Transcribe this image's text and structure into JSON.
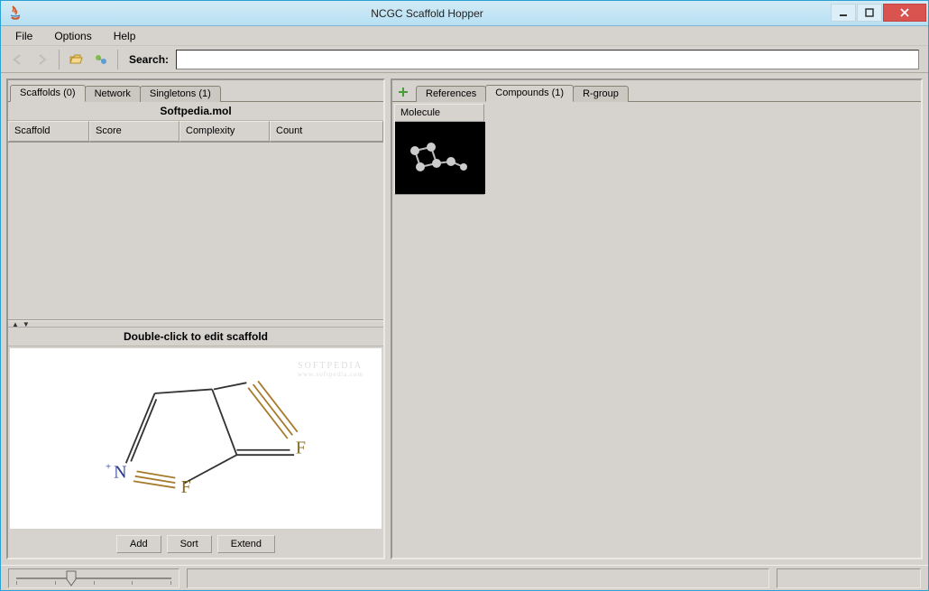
{
  "window": {
    "title": "NCGC Scaffold Hopper"
  },
  "menubar": {
    "file": "File",
    "options": "Options",
    "help": "Help"
  },
  "toolbar": {
    "search_label": "Search:",
    "search_value": ""
  },
  "left_tabs": {
    "scaffolds": "Scaffolds (0)",
    "network": "Network",
    "singletons": "Singletons (1)"
  },
  "right_tabs": {
    "references": "References",
    "compounds": "Compounds (1)",
    "rgroup": "R-group"
  },
  "file_header": "Softpedia.mol",
  "columns": {
    "scaffold": "Scaffold",
    "score": "Score",
    "complexity": "Complexity",
    "count": "Count"
  },
  "editor_label": "Double-click to edit scaffold",
  "buttons": {
    "add": "Add",
    "sort": "Sort",
    "extend": "Extend"
  },
  "molecule_label": "Molecule",
  "atoms": {
    "n_plus": "N",
    "f1": "F",
    "f2": "F",
    "plus": "+"
  },
  "watermark": {
    "big": "SOFTPEDIA",
    "small": "www.softpedia.com"
  }
}
